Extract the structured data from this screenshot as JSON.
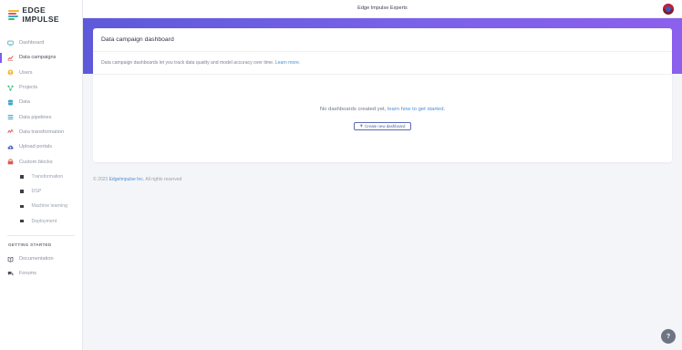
{
  "app": {
    "logo_text": "EDGE IMPULSE",
    "project_title": "Edge Impulse Experts"
  },
  "sidebar": {
    "items": [
      {
        "label": "Dashboard",
        "icon": "monitor-icon",
        "color": "#4fb0c6"
      },
      {
        "label": "Data campaigns",
        "icon": "line-chart-icon",
        "color": "#e0574f"
      },
      {
        "label": "Users",
        "icon": "users-icon",
        "color": "#f2b630"
      },
      {
        "label": "Projects",
        "icon": "network-icon",
        "color": "#3cb87a"
      },
      {
        "label": "Data",
        "icon": "database-icon",
        "color": "#3aa8c9"
      },
      {
        "label": "Data pipelines",
        "icon": "list-icon",
        "color": "#3aa8c9"
      },
      {
        "label": "Data transformation",
        "icon": "transform-icon",
        "color": "#e0574f"
      },
      {
        "label": "Upload portals",
        "icon": "cloud-upload-icon",
        "color": "#4660c8"
      },
      {
        "label": "Custom blocks",
        "icon": "blocks-icon",
        "color": "#e0574f"
      }
    ],
    "sub_items": [
      {
        "label": "Transformation"
      },
      {
        "label": "DSP"
      },
      {
        "label": "Machine learning"
      },
      {
        "label": "Deployment"
      }
    ],
    "section_label": "GETTING STARTED",
    "getting_started": [
      {
        "label": "Documentation",
        "icon": "book-icon"
      },
      {
        "label": "Forums",
        "icon": "chat-icon"
      }
    ]
  },
  "main": {
    "card_title": "Data campaign dashboard",
    "description": "Data campaign dashboards let you track data quality and model accuracy over time.",
    "learn_more": "Learn more.",
    "empty_text": "No dashboards created yet,",
    "empty_link": "learn how to get started.",
    "create_button": "Create new dashboard"
  },
  "footer": {
    "prefix": "© 2023",
    "company": "EdgeImpulse Inc.",
    "suffix": "All rights reserved"
  },
  "colors": {
    "accent": "#7a5cf0",
    "banner_start": "#5d5ad9",
    "banner_end": "#8b60ec",
    "link": "#4b8fd6"
  }
}
